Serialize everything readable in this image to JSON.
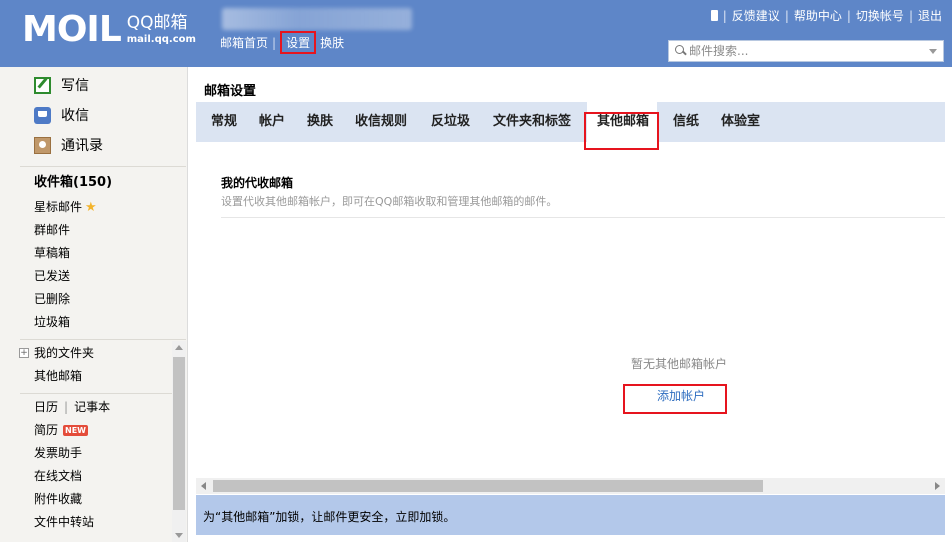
{
  "header": {
    "logo_mail": "MOIL",
    "logo_brand": "QQ邮箱",
    "logo_url": "mail.qq.com",
    "nav": {
      "home": "邮箱首页",
      "settings": "设置",
      "skin": "换肤"
    },
    "links": {
      "feedback": "反馈建议",
      "help": "帮助中心",
      "switch_account": "切换帐号",
      "logout": "退出"
    },
    "search": {
      "placeholder": "邮件搜索..."
    }
  },
  "sidebar": {
    "actions": {
      "compose": "写信",
      "receive": "收信",
      "contacts": "通讯录"
    },
    "folders": {
      "inbox": "收件箱(150)",
      "starred": "星标邮件",
      "group": "群邮件",
      "drafts": "草稿箱",
      "sent": "已发送",
      "deleted": "已删除",
      "spam": "垃圾箱"
    },
    "my_folders": "我的文件夹",
    "other_mailbox": "其他邮箱",
    "tools": {
      "calendar": "日历",
      "notes": "记事本",
      "resume": "简历",
      "resume_badge": "NEW",
      "invoice": "发票助手",
      "docs": "在线文档",
      "attachments": "附件收藏",
      "file_transfer": "文件中转站"
    }
  },
  "main": {
    "title": "邮箱设置",
    "tabs": [
      "常规",
      "帐户",
      "换肤",
      "收信规则",
      "反垃圾",
      "文件夹和标签",
      "其他邮箱",
      "信纸",
      "体验室"
    ],
    "active_tab": "其他邮箱",
    "section": {
      "title": "我的代收邮箱",
      "desc": "设置代收其他邮箱帐户，即可在QQ邮箱收取和管理其他邮箱的邮件。"
    },
    "empty_text": "暂无其他邮箱帐户",
    "add_account": "添加帐户",
    "bottom_notice": "为“其他邮箱”加锁，让邮件更安全，立即加锁。"
  },
  "colors": {
    "header_bg": "#5e86c8",
    "tab_bar_bg": "#dbe4f2",
    "bottom_bar_bg": "#b3c8ea",
    "link": "#2f6ec0",
    "highlight_box": "#e6141e"
  }
}
